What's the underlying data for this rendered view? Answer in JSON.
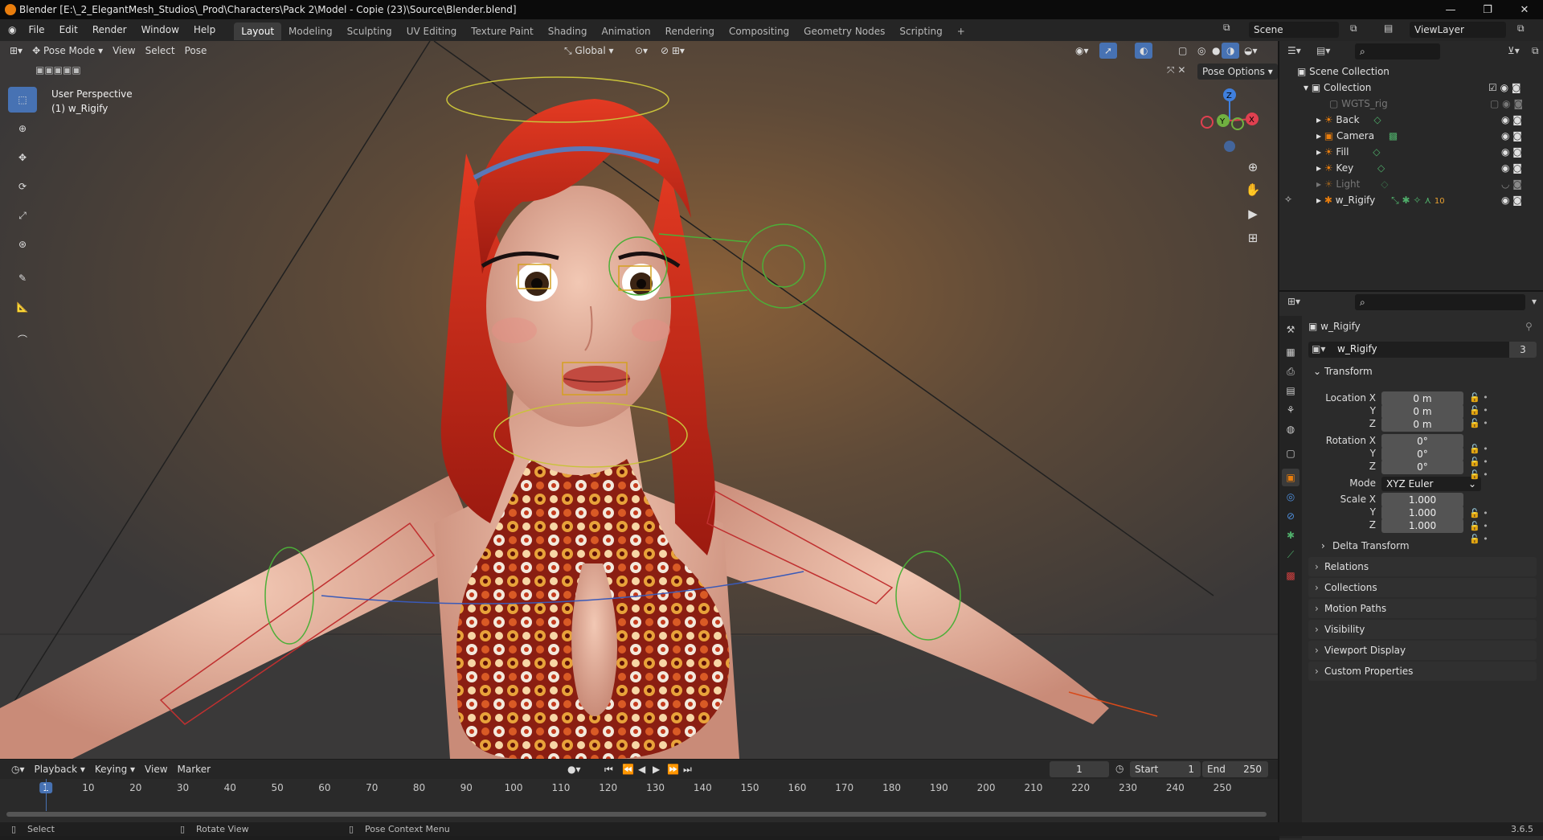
{
  "window": {
    "title": "Blender [E:\\_2_ElegantMesh_Studios\\_Prod\\Characters\\Pack 2\\Model - Copie (23)\\Source\\Blender.blend]",
    "minimize": "—",
    "maximize": "❐",
    "close": "✕"
  },
  "menu": [
    "File",
    "Edit",
    "Render",
    "Window",
    "Help"
  ],
  "workspaces": [
    "Layout",
    "Modeling",
    "Sculpting",
    "UV Editing",
    "Texture Paint",
    "Shading",
    "Animation",
    "Rendering",
    "Compositing",
    "Geometry Nodes",
    "Scripting"
  ],
  "active_workspace": "Layout",
  "scene": {
    "label": "Scene",
    "view_layer": "ViewLayer"
  },
  "viewport": {
    "mode": "Pose Mode",
    "menus": [
      "View",
      "Select",
      "Pose"
    ],
    "orientation": "Global",
    "perspective": "User Perspective",
    "object_info": "(1) w_Rigify",
    "pose_options": "Pose Options",
    "gizmo": {
      "x": "X",
      "y": "Y",
      "z": "Z"
    }
  },
  "outliner": {
    "scene_collection": "Scene Collection",
    "collection": "Collection",
    "items": [
      {
        "name": "WGTS_rig",
        "dim": true
      },
      {
        "name": "Back",
        "dim": false
      },
      {
        "name": "Camera",
        "dim": false
      },
      {
        "name": "Fill",
        "dim": false
      },
      {
        "name": "Key",
        "dim": false
      },
      {
        "name": "Light",
        "dim": true
      },
      {
        "name": "w_Rigify",
        "dim": false
      }
    ],
    "rigify_badge": "10"
  },
  "properties": {
    "object_name": "w_Rigify",
    "data_name": "w_Rigify",
    "users": "3",
    "transform": "Transform",
    "location": {
      "label": "Location X",
      "y": "Y",
      "z": "Z",
      "values": [
        "0 m",
        "0 m",
        "0 m"
      ]
    },
    "rotation": {
      "label": "Rotation X",
      "y": "Y",
      "z": "Z",
      "values": [
        "0°",
        "0°",
        "0°"
      ]
    },
    "mode": {
      "label": "Mode",
      "value": "XYZ Euler"
    },
    "scale": {
      "label": "Scale X",
      "y": "Y",
      "z": "Z",
      "values": [
        "1.000",
        "1.000",
        "1.000"
      ]
    },
    "panels": [
      "Delta Transform",
      "Relations",
      "Collections",
      "Motion Paths",
      "Visibility",
      "Viewport Display",
      "Custom Properties"
    ]
  },
  "timeline": {
    "menus": [
      "Playback",
      "Keying",
      "View",
      "Marker"
    ],
    "current_frame": "1",
    "start_label": "Start",
    "start": "1",
    "end_label": "End",
    "end": "250",
    "ticks": [
      "1",
      "10",
      "20",
      "30",
      "40",
      "50",
      "60",
      "70",
      "80",
      "90",
      "100",
      "110",
      "120",
      "130",
      "140",
      "150",
      "160",
      "170",
      "180",
      "190",
      "200",
      "210",
      "220",
      "230",
      "240",
      "250"
    ]
  },
  "status": {
    "select": "Select",
    "rotate": "Rotate View",
    "context": "Pose Context Menu",
    "version": "3.6.5"
  },
  "colors": {
    "accent": "#4772b3",
    "hair": "#cc2a1a",
    "skin": "#e8b39c",
    "orange_icon": "#e87d0d"
  }
}
